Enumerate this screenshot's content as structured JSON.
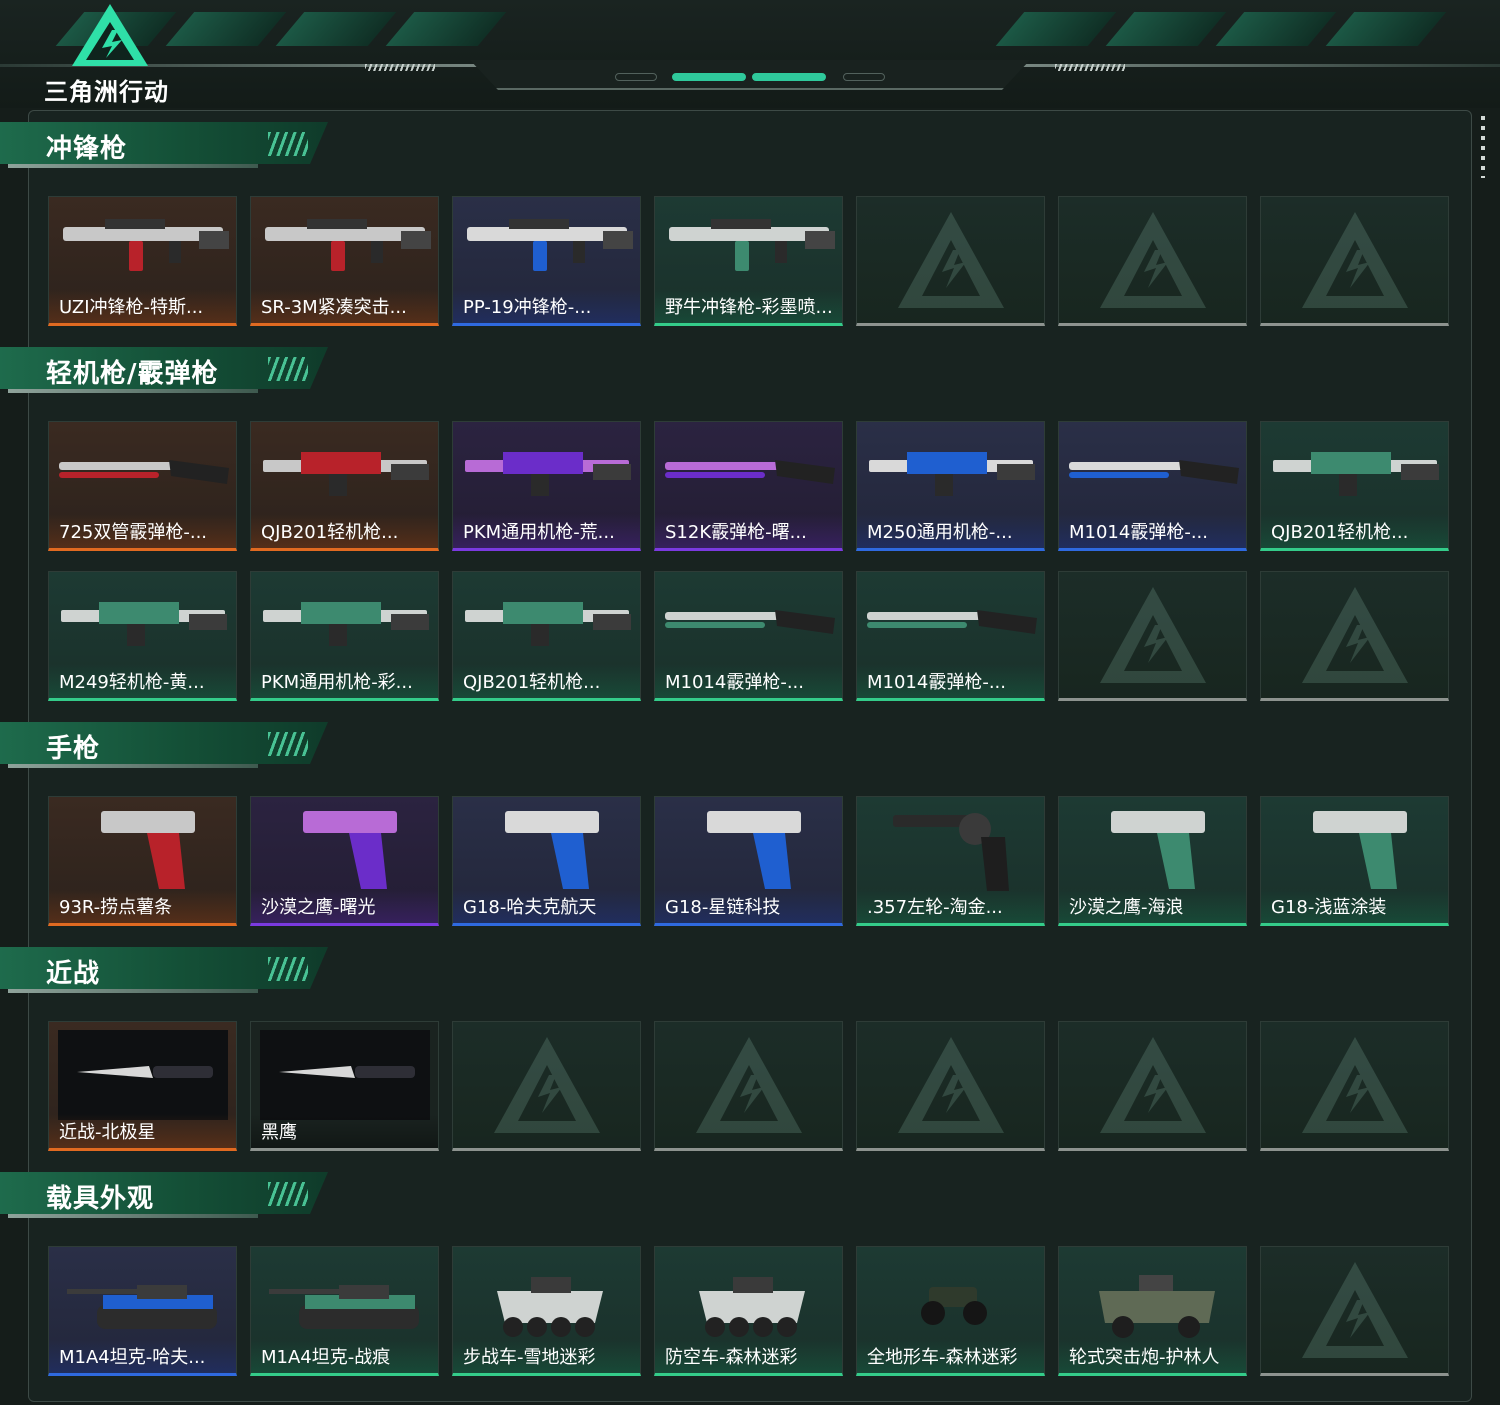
{
  "app": {
    "title": "三角洲行动"
  },
  "colors": {
    "orange": "#e06a21",
    "blue": "#2f6ae0",
    "green": "#34cc8a",
    "purple": "#7b3ae0",
    "empty": "#8d938f",
    "accent": "#2fc99b"
  },
  "sections": [
    {
      "title": "冲锋枪",
      "items": [
        {
          "name": "UZI冲锋枪-特斯...",
          "rarity": "orange",
          "icon": "smg-icon"
        },
        {
          "name": "SR-3M紧凑突击...",
          "rarity": "orange",
          "icon": "smg-icon"
        },
        {
          "name": "PP-19冲锋枪-...",
          "rarity": "blue",
          "icon": "smg-icon"
        },
        {
          "name": "野牛冲锋枪-彩墨喷...",
          "rarity": "green",
          "icon": "smg-icon"
        },
        {
          "name": "",
          "rarity": "empty"
        },
        {
          "name": "",
          "rarity": "empty"
        },
        {
          "name": "",
          "rarity": "empty"
        }
      ]
    },
    {
      "title": "轻机枪/霰弹枪",
      "items": [
        {
          "name": "725双管霰弹枪-...",
          "rarity": "orange",
          "icon": "shotgun-icon"
        },
        {
          "name": "QJB201轻机枪...",
          "rarity": "orange",
          "icon": "lmg-icon"
        },
        {
          "name": "PKM通用机枪-荒...",
          "rarity": "purple",
          "icon": "lmg-icon"
        },
        {
          "name": "S12K霰弹枪-曙...",
          "rarity": "purple",
          "icon": "shotgun-icon"
        },
        {
          "name": "M250通用机枪-...",
          "rarity": "blue",
          "icon": "lmg-icon"
        },
        {
          "name": "M1014霰弹枪-...",
          "rarity": "blue",
          "icon": "shotgun-icon"
        },
        {
          "name": "QJB201轻机枪...",
          "rarity": "green",
          "icon": "lmg-icon"
        },
        {
          "name": "M249轻机枪-黄...",
          "rarity": "green",
          "icon": "lmg-icon"
        },
        {
          "name": "PKM通用机枪-彩...",
          "rarity": "green",
          "icon": "lmg-icon"
        },
        {
          "name": "QJB201轻机枪...",
          "rarity": "green",
          "icon": "lmg-icon"
        },
        {
          "name": "M1014霰弹枪-...",
          "rarity": "green",
          "icon": "shotgun-icon"
        },
        {
          "name": "M1014霰弹枪-...",
          "rarity": "green",
          "icon": "shotgun-icon"
        },
        {
          "name": "",
          "rarity": "empty"
        },
        {
          "name": "",
          "rarity": "empty"
        }
      ]
    },
    {
      "title": "手枪",
      "items": [
        {
          "name": "93R-捞点薯条",
          "rarity": "orange",
          "icon": "pistol-icon"
        },
        {
          "name": "沙漠之鹰-曙光",
          "rarity": "purple",
          "icon": "pistol-icon"
        },
        {
          "name": "G18-哈夫克航天",
          "rarity": "blue",
          "icon": "pistol-icon"
        },
        {
          "name": "G18-星链科技",
          "rarity": "blue",
          "icon": "pistol-icon"
        },
        {
          "name": ".357左轮-淘金...",
          "rarity": "green",
          "icon": "revolver-icon"
        },
        {
          "name": "沙漠之鹰-海浪",
          "rarity": "green",
          "icon": "pistol-icon"
        },
        {
          "name": "G18-浅蓝涂装",
          "rarity": "green",
          "icon": "pistol-icon"
        }
      ]
    },
    {
      "title": "近战",
      "items": [
        {
          "name": "近战-北极星",
          "rarity": "orange",
          "icon": "knife-icon"
        },
        {
          "name": "黑鹰",
          "rarity": "empty",
          "icon": "knife-icon"
        },
        {
          "name": "",
          "rarity": "empty"
        },
        {
          "name": "",
          "rarity": "empty"
        },
        {
          "name": "",
          "rarity": "empty"
        },
        {
          "name": "",
          "rarity": "empty"
        },
        {
          "name": "",
          "rarity": "empty"
        }
      ]
    },
    {
      "title": "载具外观",
      "items": [
        {
          "name": "M1A4坦克-哈夫...",
          "rarity": "blue",
          "icon": "tank-icon"
        },
        {
          "name": "M1A4坦克-战痕",
          "rarity": "green",
          "icon": "tank-icon"
        },
        {
          "name": "步战车-雪地迷彩",
          "rarity": "green",
          "icon": "apc-icon"
        },
        {
          "name": "防空车-森林迷彩",
          "rarity": "green",
          "icon": "apc-icon"
        },
        {
          "name": "全地形车-森林迷彩",
          "rarity": "green",
          "icon": "atv-icon"
        },
        {
          "name": "轮式突击炮-护林人",
          "rarity": "green",
          "icon": "armored-car-icon"
        },
        {
          "name": "",
          "rarity": "empty"
        }
      ]
    }
  ]
}
